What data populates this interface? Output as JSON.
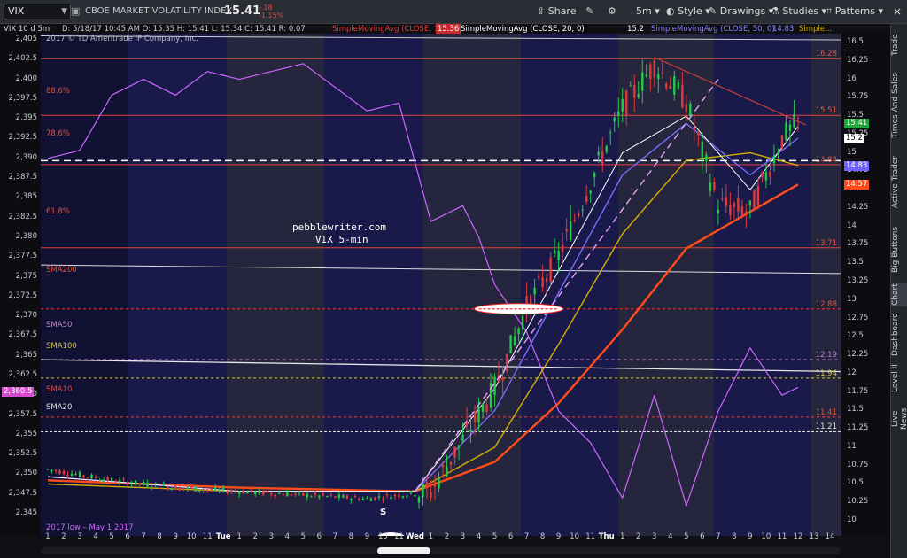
{
  "toolbar": {
    "symbol": "VIX",
    "instrument_name": "CBOE MARKET VOLATILITY INDEX",
    "last": "15.41",
    "change": "-.18",
    "change_pct": "-1.15%",
    "share": "Share",
    "timeframe": "5m",
    "style": "Style",
    "drawings": "Drawings",
    "studies": "Studies",
    "patterns": "Patterns"
  },
  "infobar": {
    "series": "VIX 10 d 5m",
    "ohlc": "D: 5/18/17 10:45 AM  O: 15.35  H: 15.41  L: 15.34  C: 15.41  R: 0.07",
    "sma10": "SimpleMovingAvg (CLOSE, 10, 0)",
    "sma10_val": "15.36",
    "sma20": "SimpleMovingAvg (CLOSE, 20, 0)",
    "sma20_val": "15.2",
    "sma50": "SimpleMovingAvg (CLOSE, 50, 0)",
    "sma50_val": "14.83",
    "more": "Simple...",
    "copyright": "2017 © TD Ameritrade IP Company, Inc."
  },
  "overlay": {
    "site": "pebblewriter.com",
    "title": "VIX 5-min",
    "low_note": "2017 low – May 1 2017",
    "s_marker": "S",
    "pct_labels": [
      "88.6%",
      "78.6%",
      "61.8%",
      "SMA200",
      "SMA50",
      "SMA100",
      "SMA10",
      "SMA20"
    ],
    "left_tag": "2,360.5"
  },
  "right_level_labels": [
    "16.28",
    "15.51",
    "14.84",
    "13.71",
    "12.88",
    "12.19",
    "11.94",
    "11.41",
    "11.21"
  ],
  "price_badges": {
    "last": "15.41",
    "sma20": "15.2",
    "sma50": "14.83",
    "sma100": "14.57"
  },
  "colors": {
    "up": "#22cc44",
    "down": "#e03a3a",
    "spx": "#cc66ff",
    "sma10": "#ffffff",
    "sma20": "#7a6cff",
    "sma50": "#d4b000",
    "sma100": "#ff4d1a",
    "fib": "#d23a3a",
    "accent": "#2d5fd1"
  },
  "sidebar_tabs": [
    "Trade",
    "Times And Sales",
    "Active Trader",
    "Big Buttons",
    "Chart",
    "Dashboard",
    "Level II",
    "Live News"
  ],
  "chart_data": {
    "type": "line",
    "left_axis_ticks": [
      "2,405",
      "2,402.5",
      "2,400",
      "2,397.5",
      "2,395",
      "2,392.5",
      "2,390",
      "2,387.5",
      "2,385",
      "2,382.5",
      "2,380",
      "2,377.5",
      "2,375",
      "2,372.5",
      "2,370",
      "2,367.5",
      "2,365",
      "2,362.5",
      "2,360",
      "2,357.5",
      "2,355",
      "2,352.5",
      "2,350",
      "2,347.5",
      "2,345"
    ],
    "right_axis_ticks": [
      "16.5",
      "16.25",
      "16",
      "15.75",
      "15.5",
      "15.25",
      "15",
      "14.75",
      "14.5",
      "14.25",
      "14",
      "13.75",
      "13.5",
      "13.25",
      "13",
      "12.75",
      "12.5",
      "12.25",
      "12",
      "11.75",
      "11.5",
      "11.25",
      "11",
      "10.75",
      "10.5",
      "10.25",
      "10"
    ],
    "x_labels": [
      "1",
      "2",
      "3",
      "4",
      "5",
      "6",
      "7",
      "8",
      "9",
      "10",
      "11",
      "Tue",
      "1",
      "2",
      "3",
      "4",
      "5",
      "6",
      "7",
      "8",
      "9",
      "10",
      "11",
      "Wed",
      "1",
      "2",
      "3",
      "4",
      "5",
      "6",
      "7",
      "8",
      "9",
      "10",
      "11",
      "Thu",
      "1",
      "2",
      "3",
      "4",
      "5",
      "6",
      "7",
      "8",
      "9",
      "10",
      "11",
      "12",
      "13",
      "14"
    ],
    "ylim_left": [
      2345,
      2405
    ],
    "ylim_right": [
      10,
      16.5
    ],
    "series": [
      {
        "name": "VIX",
        "axis": "right",
        "x_idx": [
          0,
          4,
          8,
          12,
          16,
          20,
          24,
          28,
          30,
          32,
          34,
          36,
          38,
          40,
          42,
          44,
          46,
          47
        ],
        "values": [
          10.7,
          10.55,
          10.45,
          10.4,
          10.35,
          10.3,
          10.4,
          11.8,
          12.9,
          13.6,
          14.6,
          15.6,
          16.2,
          15.7,
          14.3,
          14.2,
          15.2,
          15.41
        ]
      },
      {
        "name": "SPX",
        "axis": "left",
        "x_idx": [
          0,
          2,
          4,
          6,
          8,
          10,
          12,
          16,
          20,
          22,
          24,
          26,
          27,
          28,
          30,
          32,
          34,
          36,
          38,
          40,
          42,
          44,
          46,
          47
        ],
        "values": [
          2390,
          2391,
          2398,
          2400,
          2398,
          2401,
          2400,
          2402,
          2396,
          2397,
          2382,
          2384,
          2380,
          2374,
          2368,
          2358,
          2354,
          2347,
          2360,
          2346,
          2358,
          2366,
          2360,
          2361
        ]
      },
      {
        "name": "SMA10",
        "axis": "right",
        "x_idx": [
          0,
          12,
          23,
          28,
          32,
          36,
          40,
          44,
          47
        ],
        "values": [
          10.6,
          10.4,
          10.4,
          11.8,
          13.4,
          15.0,
          15.5,
          14.5,
          15.36
        ]
      },
      {
        "name": "SMA20",
        "axis": "right",
        "x_idx": [
          0,
          12,
          23,
          28,
          32,
          36,
          40,
          44,
          47
        ],
        "values": [
          10.6,
          10.4,
          10.4,
          11.5,
          13.1,
          14.7,
          15.4,
          14.7,
          15.2
        ]
      },
      {
        "name": "SMA50",
        "axis": "right",
        "x_idx": [
          0,
          12,
          23,
          28,
          32,
          36,
          40,
          44,
          47
        ],
        "values": [
          10.5,
          10.4,
          10.4,
          11.0,
          12.4,
          13.9,
          14.9,
          15.0,
          14.83
        ]
      },
      {
        "name": "SMA100",
        "axis": "right",
        "x_idx": [
          0,
          12,
          23,
          28,
          32,
          36,
          40,
          44,
          47
        ],
        "values": [
          10.55,
          10.45,
          10.4,
          10.8,
          11.6,
          12.6,
          13.7,
          14.2,
          14.57
        ]
      }
    ],
    "horizontal_levels": [
      16.28,
      15.51,
      14.84,
      13.71,
      12.88,
      12.19,
      11.94,
      11.41,
      11.21
    ]
  }
}
